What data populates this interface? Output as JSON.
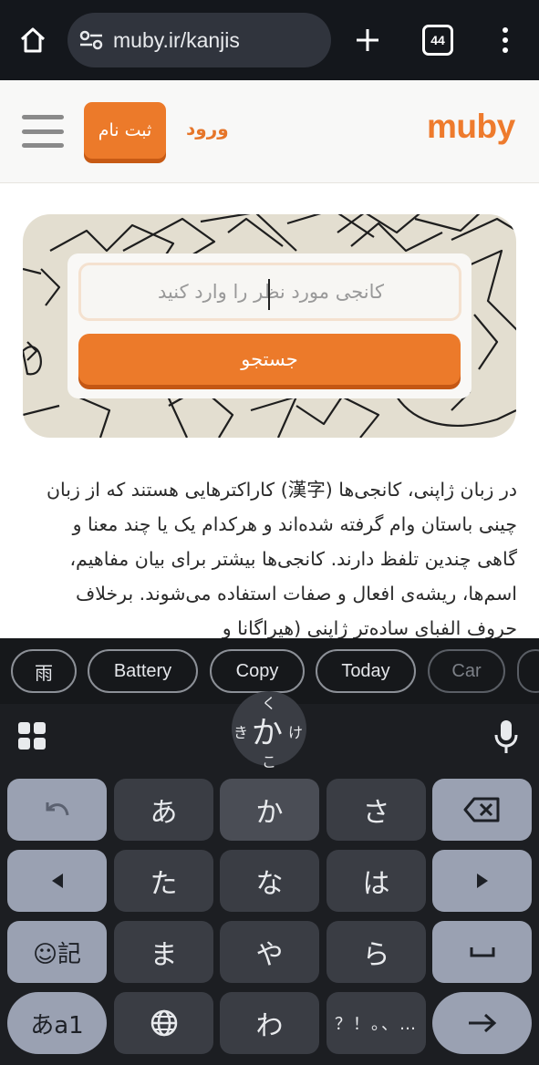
{
  "browser": {
    "url": "muby.ir/kanjis",
    "tab_count": "44"
  },
  "header": {
    "logo": "muby",
    "login": "ورود",
    "signup": "ثبت نام"
  },
  "search": {
    "placeholder": "کانجی مورد نظر را وارد کنید",
    "button": "جستجو"
  },
  "intro": {
    "text": "در زبان ژاپنی، کانجی‌ها (漢字) کاراکترهایی هستند که از زبان چینی باستان وام گرفته شده‌اند و هرکدام یک یا چند معنا و گاهی چندین تلفظ دارند. کانجی‌ها بیشتر برای بیان مفاهیم، اسم‌ها، ریشه‌ی افعال و صفات استفاده می‌شوند. برخلاف حروف الفبای ساده‌تر ژاپنی (هیراگانا و"
  },
  "keyboard": {
    "suggestions": [
      "雨",
      "Battery",
      "Copy",
      "Today",
      "Car"
    ],
    "flick": {
      "center": "か",
      "top": "く",
      "left": "き",
      "right": "け",
      "bottom": "こ"
    },
    "rows": [
      [
        "あ",
        "か",
        "さ"
      ],
      [
        "た",
        "な",
        "は"
      ],
      [
        "ま",
        "や",
        "ら"
      ]
    ],
    "emoji_label": "☺記",
    "mode_label": "あa1",
    "wa": "わ",
    "punct_key": "？！。、…"
  }
}
